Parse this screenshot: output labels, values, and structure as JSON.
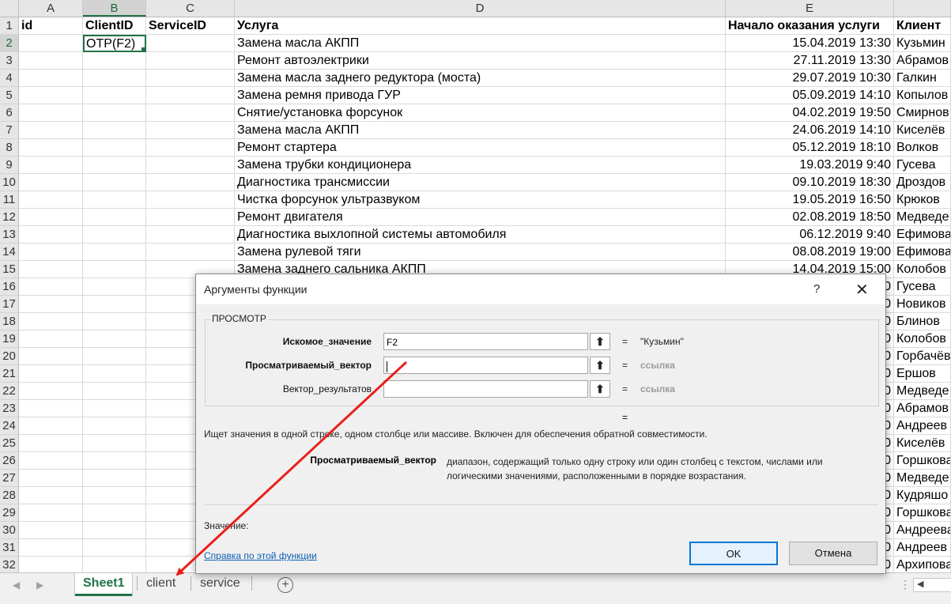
{
  "columns": [
    {
      "letter": "A",
      "selected": false
    },
    {
      "letter": "B",
      "selected": true
    },
    {
      "letter": "C",
      "selected": false
    },
    {
      "letter": "D",
      "selected": false
    },
    {
      "letter": "E",
      "selected": false
    },
    {
      "letter": "",
      "selected": false
    }
  ],
  "header_row": {
    "num": "1",
    "id": "id",
    "clientid": "ClientID",
    "serviceid": "ServiceID",
    "service": "Услуга",
    "start": "Начало оказания услуги",
    "client": "Клиент"
  },
  "active_cell_value": "ОТР(F2)",
  "rows": [
    {
      "num": "2",
      "service": "Замена масла АКПП",
      "start": "15.04.2019 13:30",
      "client": "Кузьмин"
    },
    {
      "num": "3",
      "service": "Ремонт автоэлектрики",
      "start": "27.11.2019 13:30",
      "client": "Абрамов"
    },
    {
      "num": "4",
      "service": "Замена масла заднего редуктора (моста)",
      "start": "29.07.2019 10:30",
      "client": "Галкин"
    },
    {
      "num": "5",
      "service": "Замена ремня привода ГУР",
      "start": "05.09.2019 14:10",
      "client": "Копылов"
    },
    {
      "num": "6",
      "service": "Снятие/установка форсунок",
      "start": "04.02.2019 19:50",
      "client": "Смирнов"
    },
    {
      "num": "7",
      "service": "Замена масла АКПП",
      "start": "24.06.2019 14:10",
      "client": "Киселёв"
    },
    {
      "num": "8",
      "service": "Ремонт стартера",
      "start": "05.12.2019 18:10",
      "client": "Волков"
    },
    {
      "num": "9",
      "service": "Замена трубки кондиционера",
      "start": "19.03.2019 9:40",
      "client": "Гусева"
    },
    {
      "num": "10",
      "service": "Диагностика трансмиссии",
      "start": "09.10.2019 18:30",
      "client": "Дроздов"
    },
    {
      "num": "11",
      "service": "Чистка форсунок ультразвуком",
      "start": "19.05.2019 16:50",
      "client": "Крюков"
    },
    {
      "num": "12",
      "service": "Ремонт двигателя",
      "start": "02.08.2019 18:50",
      "client": "Медведе"
    },
    {
      "num": "13",
      "service": "Диагностика выхлопной системы автомобиля",
      "start": "06.12.2019 9:40",
      "client": "Ефимова"
    },
    {
      "num": "14",
      "service": "Замена рулевой тяги",
      "start": "08.08.2019 19:00",
      "client": "Ефимова"
    },
    {
      "num": "15",
      "service": "Замена заднего сальника АКПП",
      "start": "14.04.2019 15:00",
      "client": "Колобов"
    },
    {
      "num": "16",
      "service": "",
      "start": "0",
      "client": "Гусева"
    },
    {
      "num": "17",
      "service": "",
      "start": "0",
      "client": "Новиков"
    },
    {
      "num": "18",
      "service": "",
      "start": "0",
      "client": "Блинов"
    },
    {
      "num": "19",
      "service": "",
      "start": "0",
      "client": "Колобов"
    },
    {
      "num": "20",
      "service": "",
      "start": "0",
      "client": "Горбачёв"
    },
    {
      "num": "21",
      "service": "",
      "start": "0",
      "client": "Ершов"
    },
    {
      "num": "22",
      "service": "",
      "start": "0",
      "client": "Медведе"
    },
    {
      "num": "23",
      "service": "",
      "start": "0",
      "client": "Абрамов"
    },
    {
      "num": "24",
      "service": "",
      "start": "0",
      "client": "Андреев"
    },
    {
      "num": "25",
      "service": "",
      "start": "0",
      "client": "Киселёв"
    },
    {
      "num": "26",
      "service": "",
      "start": "0",
      "client": "Горшкова"
    },
    {
      "num": "27",
      "service": "",
      "start": "0",
      "client": "Медведе"
    },
    {
      "num": "28",
      "service": "",
      "start": "0",
      "client": "Кудряшо"
    },
    {
      "num": "29",
      "service": "",
      "start": "0",
      "client": "Горшкова"
    },
    {
      "num": "30",
      "service": "",
      "start": "0",
      "client": "Андреева"
    },
    {
      "num": "31",
      "service": "",
      "start": "0",
      "client": "Андреев"
    },
    {
      "num": "32",
      "service": "",
      "start": "0",
      "client": "Архипова"
    }
  ],
  "sheets": [
    {
      "label": "Sheet1",
      "active": true
    },
    {
      "label": "client",
      "active": false
    },
    {
      "label": "service",
      "active": false
    }
  ],
  "add_sheet_symbol": "+",
  "dialog": {
    "title": "Аргументы функции",
    "help_symbol": "?",
    "close_symbol": "✕",
    "group_label": "ПРОСМОТР",
    "args": [
      {
        "label": "Искомое_значение",
        "value": "F2",
        "result": "\"Кузьмин\"",
        "bold": true,
        "grey": false
      },
      {
        "label": "Просматриваемый_вектор",
        "value": "",
        "result": "ссылка",
        "bold": true,
        "grey": true
      },
      {
        "label": "Вектор_результатов",
        "value": "",
        "result": "ссылка",
        "bold": false,
        "grey": true
      }
    ],
    "equals": "=",
    "description": "Ищет значения в одной строке, одном столбце или массиве. Включен для обеспечения обратной совместимости.",
    "arg_desc_label": "Просматриваемый_вектор",
    "arg_desc_text": "диапазон, содержащий только одну строку или один столбец с текстом, числами или логическими значениями, расположенными в порядке возрастания.",
    "value_label": "Значение:",
    "help_link": "Справка по этой функции",
    "ok_label": "OK",
    "cancel_label": "Отмена"
  },
  "colors": {
    "excel_green": "#217346",
    "arrow_red": "#e8201a",
    "link_blue": "#0b5fb5"
  }
}
